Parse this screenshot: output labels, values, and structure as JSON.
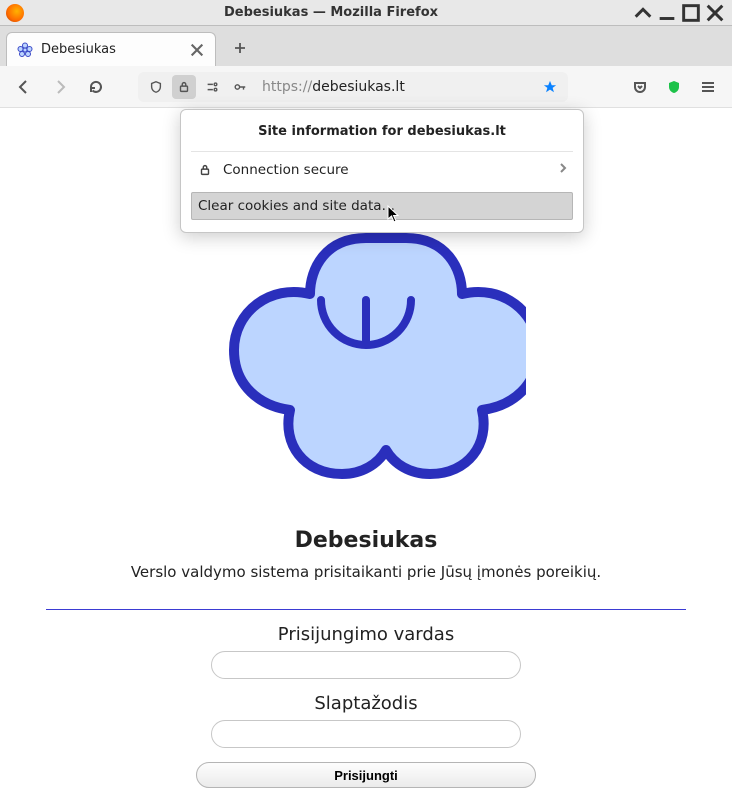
{
  "window": {
    "title": "Debesiukas — Mozilla Firefox"
  },
  "tab": {
    "label": "Debesiukas"
  },
  "url": {
    "prefix": "https://",
    "domain": "debesiukas.lt"
  },
  "popup": {
    "title": "Site information for debesiukas.lt",
    "connection": "Connection secure",
    "clear": "Clear cookies and site data…"
  },
  "page": {
    "brand": "Debesiukas",
    "subtitle": "Verslo valdymo sistema prisitaikanti prie Jūsų įmonės poreikių.",
    "username_label": "Prisijungimo vardas",
    "password_label": "Slaptažodis",
    "login_button": "Prisijungti"
  }
}
